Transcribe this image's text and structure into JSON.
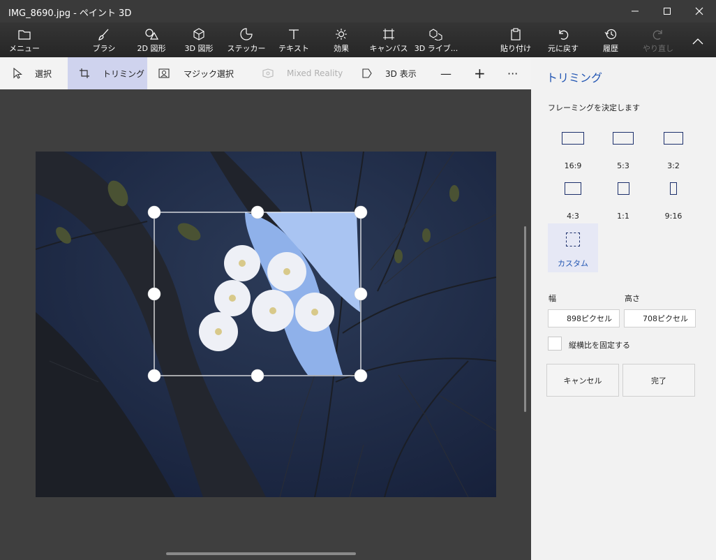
{
  "window": {
    "title": "IMG_8690.jpg - ペイント 3D"
  },
  "toolbar": {
    "menu": "メニュー",
    "brush": "ブラシ",
    "shapes2d": "2D 図形",
    "shapes3d": "3D 図形",
    "stickers": "ステッカー",
    "text": "テキスト",
    "effects": "効果",
    "canvas": "キャンバス",
    "library3d": "3D ライブ...",
    "paste": "貼り付け",
    "undo": "元に戻す",
    "history": "履歴",
    "redo": "やり直し"
  },
  "subbar": {
    "select": "選択",
    "crop": "トリミング",
    "magic_select": "マジック選択",
    "mixed_reality": "Mixed Reality",
    "view3d": "3D 表示",
    "zoom_out": "—",
    "zoom_in": "+",
    "more": "···"
  },
  "panel": {
    "title": "トリミング",
    "subtitle": "フレーミングを決定します",
    "ratios": [
      "16:9",
      "5:3",
      "3:2",
      "4:3",
      "1:1",
      "9:16"
    ],
    "custom": "カスタム",
    "width_label": "幅",
    "height_label": "高さ",
    "width_value": "898ピクセル",
    "height_value": "708ピクセル",
    "lock_aspect": "縦横比を固定する",
    "cancel": "キャンセル",
    "done": "完了"
  },
  "colors": {
    "accent": "#2457b3",
    "active_tab": "#cfd3ee"
  }
}
